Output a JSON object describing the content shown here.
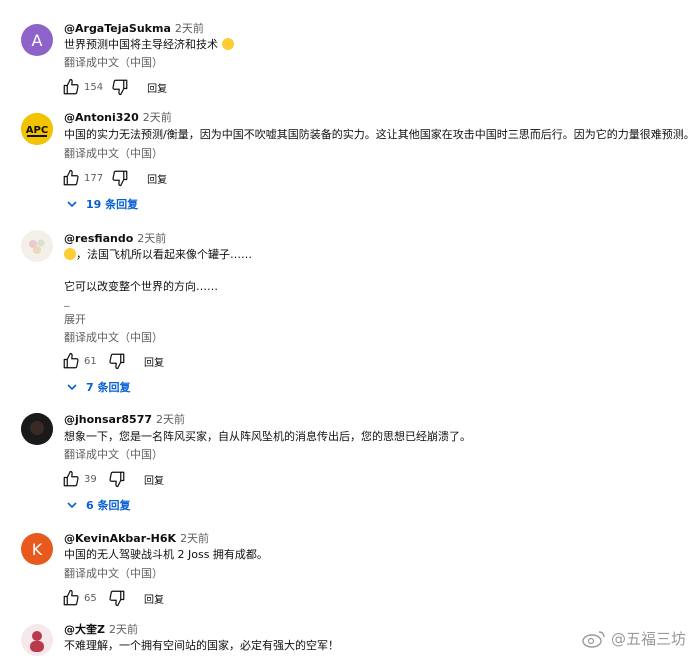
{
  "comments": [
    {
      "avatar_letter": "A",
      "username": "@ArgaTejaSukma",
      "time": "2天前",
      "text_lines": [
        "世界预测中国将主导经济和技术"
      ],
      "translate": "翻译成中文（中国）",
      "likes": "154",
      "reply": "回复"
    },
    {
      "avatar_label": "APC",
      "username": "@Antoni320",
      "time": "2天前",
      "text_lines": [
        "中国的实力无法预测/衡量，因为中国不吹嘘其国防装备的实力。这让其他国家在攻击中国时三思而后行。因为它的力量很难预测。"
      ],
      "translate": "翻译成中文（中国）",
      "likes": "177",
      "reply": "回复",
      "replies": "19 条回复"
    },
    {
      "username": "@resfiando",
      "time": "2天前",
      "text_lines": [
        "，法国飞机所以看起来像个罐子……",
        "它可以改变整个世界的方向……",
        "_"
      ],
      "expand": "展开",
      "translate": "翻译成中文（中国）",
      "likes": "61",
      "reply": "回复",
      "replies": "7 条回复"
    },
    {
      "username": "@jhonsar8577",
      "time": "2天前",
      "text_lines": [
        "想象一下，您是一名阵风买家，自从阵风坠机的消息传出后，您的思想已经崩溃了。"
      ],
      "translate": "翻译成中文（中国）",
      "likes": "39",
      "reply": "回复",
      "replies": "6 条回复"
    },
    {
      "avatar_letter": "K",
      "username": "@KevinAkbar-H6K",
      "time": "2天前",
      "text_lines": [
        "中国的无人驾驶战斗机 2 Joss 拥有成都。"
      ],
      "translate": "翻译成中文（中国）",
      "likes": "65",
      "reply": "回复"
    },
    {
      "username": "@大奎Z",
      "time": "2天前",
      "text_lines": [
        "不难理解，一个拥有空间站的国家，必定有强大的空军！"
      ]
    }
  ],
  "watermark": "@五福三坊",
  "colors": {
    "accent": "#065fd4",
    "secondary_text": "#606060"
  }
}
